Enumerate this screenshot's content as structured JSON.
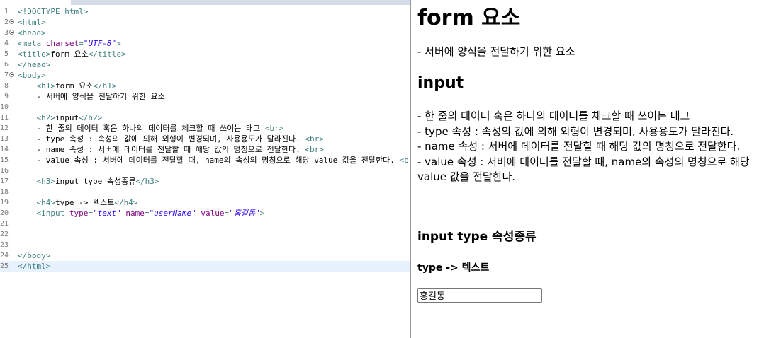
{
  "editor": {
    "lines": [
      {
        "n": "1",
        "fold": false,
        "current": false,
        "parts": [
          [
            "tag",
            "<!DOCTYPE html>"
          ]
        ]
      },
      {
        "n": "2",
        "fold": true,
        "current": false,
        "parts": [
          [
            "tag",
            "<html>"
          ]
        ]
      },
      {
        "n": "3",
        "fold": true,
        "current": false,
        "parts": [
          [
            "tag",
            "<head>"
          ]
        ]
      },
      {
        "n": "4",
        "fold": false,
        "current": false,
        "parts": [
          [
            "tag",
            "<meta "
          ],
          [
            "attr",
            "charset"
          ],
          [
            "tag",
            "="
          ],
          [
            "str",
            "\"UTF-8\""
          ],
          [
            "tag",
            ">"
          ]
        ]
      },
      {
        "n": "5",
        "fold": false,
        "current": false,
        "parts": [
          [
            "tag",
            "<title>"
          ],
          [
            "txt",
            "form 요소"
          ],
          [
            "tag",
            "</title>"
          ]
        ]
      },
      {
        "n": "6",
        "fold": false,
        "current": false,
        "parts": [
          [
            "tag",
            "</head>"
          ]
        ]
      },
      {
        "n": "7",
        "fold": true,
        "current": false,
        "parts": [
          [
            "tag",
            "<body>"
          ]
        ]
      },
      {
        "n": "8",
        "fold": false,
        "current": false,
        "parts": [
          [
            "txt",
            "    "
          ],
          [
            "tag",
            "<h1>"
          ],
          [
            "txt",
            "form 요소"
          ],
          [
            "tag",
            "</h1>"
          ]
        ]
      },
      {
        "n": "9",
        "fold": false,
        "current": false,
        "parts": [
          [
            "txt",
            "    - 서버에 양식을 전달하기 위한 요소"
          ]
        ]
      },
      {
        "n": "10",
        "fold": false,
        "current": false,
        "parts": []
      },
      {
        "n": "11",
        "fold": false,
        "current": false,
        "parts": [
          [
            "txt",
            "    "
          ],
          [
            "tag",
            "<h2>"
          ],
          [
            "txt",
            "input"
          ],
          [
            "tag",
            "</h2>"
          ]
        ]
      },
      {
        "n": "12",
        "fold": false,
        "current": false,
        "parts": [
          [
            "txt",
            "    - 한 줄의 데이터 혹은 하나의 데이터를 체크할 때 쓰이는 태그 "
          ],
          [
            "tag",
            "<br>"
          ]
        ]
      },
      {
        "n": "13",
        "fold": false,
        "current": false,
        "parts": [
          [
            "txt",
            "    - type 속성 : 속성의 값에 의해 외형이 변경되며, 사용용도가 달라진다. "
          ],
          [
            "tag",
            "<br>"
          ]
        ]
      },
      {
        "n": "14",
        "fold": false,
        "current": false,
        "parts": [
          [
            "txt",
            "    - name 속성 : 서버에 데이터를 전달할 때 해당 값의 명칭으로 전달한다. "
          ],
          [
            "tag",
            "<br>"
          ]
        ]
      },
      {
        "n": "15",
        "fold": false,
        "current": false,
        "parts": [
          [
            "txt",
            "    - value 속성 : 서버에 데이터를 전달할 때, name의 속성의 명칭으로 해당 value 값을 전달한다. "
          ],
          [
            "tag",
            "<br>"
          ]
        ]
      },
      {
        "n": "16",
        "fold": false,
        "current": false,
        "parts": []
      },
      {
        "n": "17",
        "fold": false,
        "current": false,
        "parts": [
          [
            "txt",
            "    "
          ],
          [
            "tag",
            "<h3>"
          ],
          [
            "txt",
            "input type 속성종류"
          ],
          [
            "tag",
            "</h3>"
          ]
        ]
      },
      {
        "n": "18",
        "fold": false,
        "current": false,
        "parts": []
      },
      {
        "n": "19",
        "fold": false,
        "current": false,
        "parts": [
          [
            "txt",
            "    "
          ],
          [
            "tag",
            "<h4>"
          ],
          [
            "txt",
            "type -> 텍스트"
          ],
          [
            "tag",
            "</h4>"
          ]
        ]
      },
      {
        "n": "20",
        "fold": false,
        "current": false,
        "parts": [
          [
            "txt",
            "    "
          ],
          [
            "tag",
            "<input "
          ],
          [
            "attr",
            "type"
          ],
          [
            "tag",
            "="
          ],
          [
            "str",
            "\"text\""
          ],
          [
            "txt",
            " "
          ],
          [
            "attr",
            "name"
          ],
          [
            "tag",
            "="
          ],
          [
            "str",
            "\"userName\""
          ],
          [
            "txt",
            " "
          ],
          [
            "attr",
            "value"
          ],
          [
            "tag",
            "="
          ],
          [
            "str",
            "\"홍길동\""
          ],
          [
            "tag",
            ">"
          ]
        ]
      },
      {
        "n": "21",
        "fold": false,
        "current": false,
        "parts": []
      },
      {
        "n": "22",
        "fold": false,
        "current": false,
        "parts": []
      },
      {
        "n": "23",
        "fold": false,
        "current": false,
        "parts": []
      },
      {
        "n": "24",
        "fold": false,
        "current": false,
        "parts": [
          [
            "tag",
            "</body>"
          ]
        ]
      },
      {
        "n": "25",
        "fold": false,
        "current": true,
        "parts": [
          [
            "tag",
            "</html>"
          ]
        ]
      }
    ]
  },
  "preview": {
    "h1": "form 요소",
    "desc": "- 서버에 양식을 전달하기 위한 요소",
    "h2": "input",
    "items": [
      "- 한 줄의 데이터 혹은 하나의 데이터를 체크할 때 쓰이는 태그",
      "- type 속성 : 속성의 값에 의해 외형이 변경되며, 사용용도가 달라진다.",
      "- name 속성 : 서버에 데이터를 전달할 때 해당 값의 명칭으로 전달한다.",
      "- value 속성 : 서버에 데이터를 전달할 때, name의 속성의 명칭으로 해당 value 값을 전달한다."
    ],
    "h3": "input type 속성종류",
    "h4": "type -> 텍스트",
    "input_value": "홍길동"
  }
}
